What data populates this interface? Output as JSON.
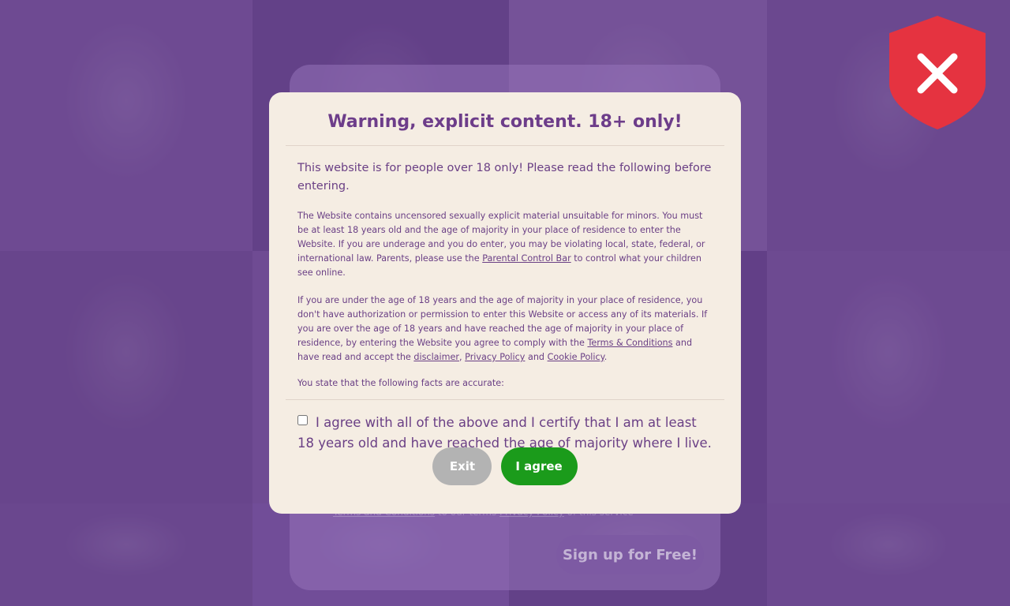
{
  "background": {
    "signup_button_label": "Sign up for Free!",
    "footer_link_terms": "Terms and Conditions",
    "footer_link_privacy": "Privacy Policy",
    "footer_text_mid": "to our terms",
    "footer_text_end": "of this service"
  },
  "shield": {
    "icon": "shield-close-icon",
    "color": "#e53340"
  },
  "modal": {
    "title": "Warning, explicit content. 18+ only!",
    "intro": "This website is for people over 18 only! Please read the following before entering.",
    "para1_a": "The Website contains uncensored sexually explicit material unsuitable for minors. You must be at least 18 years old and the age of majority in your place of residence to enter the Website. If you are underage and you do enter, you may be violating local, state, federal, or international law. Parents, please use the ",
    "para1_link": "Parental Control Bar",
    "para1_b": " to control what your children see online.",
    "para2_a": "If you are under the age of 18 years and the age of majority in your place of residence, you don't have authorization or permission to enter this Website or access any of its materials. If you are over the age of 18 years and have reached the age of majority in your place of residence, by entering the Website you agree to comply with the ",
    "para2_terms": "Terms & Conditions",
    "para2_b": " and have read and accept the ",
    "para2_disclaimer": "disclaimer",
    "para2_comma": ", ",
    "para2_privacy": "Privacy Policy",
    "para2_and": " and ",
    "para2_cookie": "Cookie Policy",
    "para2_end": ".",
    "facts": "You state that the following facts are accurate:",
    "agree_text": "I agree with all of the above and I certify that I am at least 18 years old and have reached the age of majority where I live.",
    "agree_checked": false,
    "exit_label": "Exit",
    "agree_label": "I agree"
  },
  "colors": {
    "accent": "#6d3d8a",
    "agree_button": "#1b9b1b",
    "exit_button": "#b3b3b3",
    "modal_bg": "#f5ede3"
  }
}
